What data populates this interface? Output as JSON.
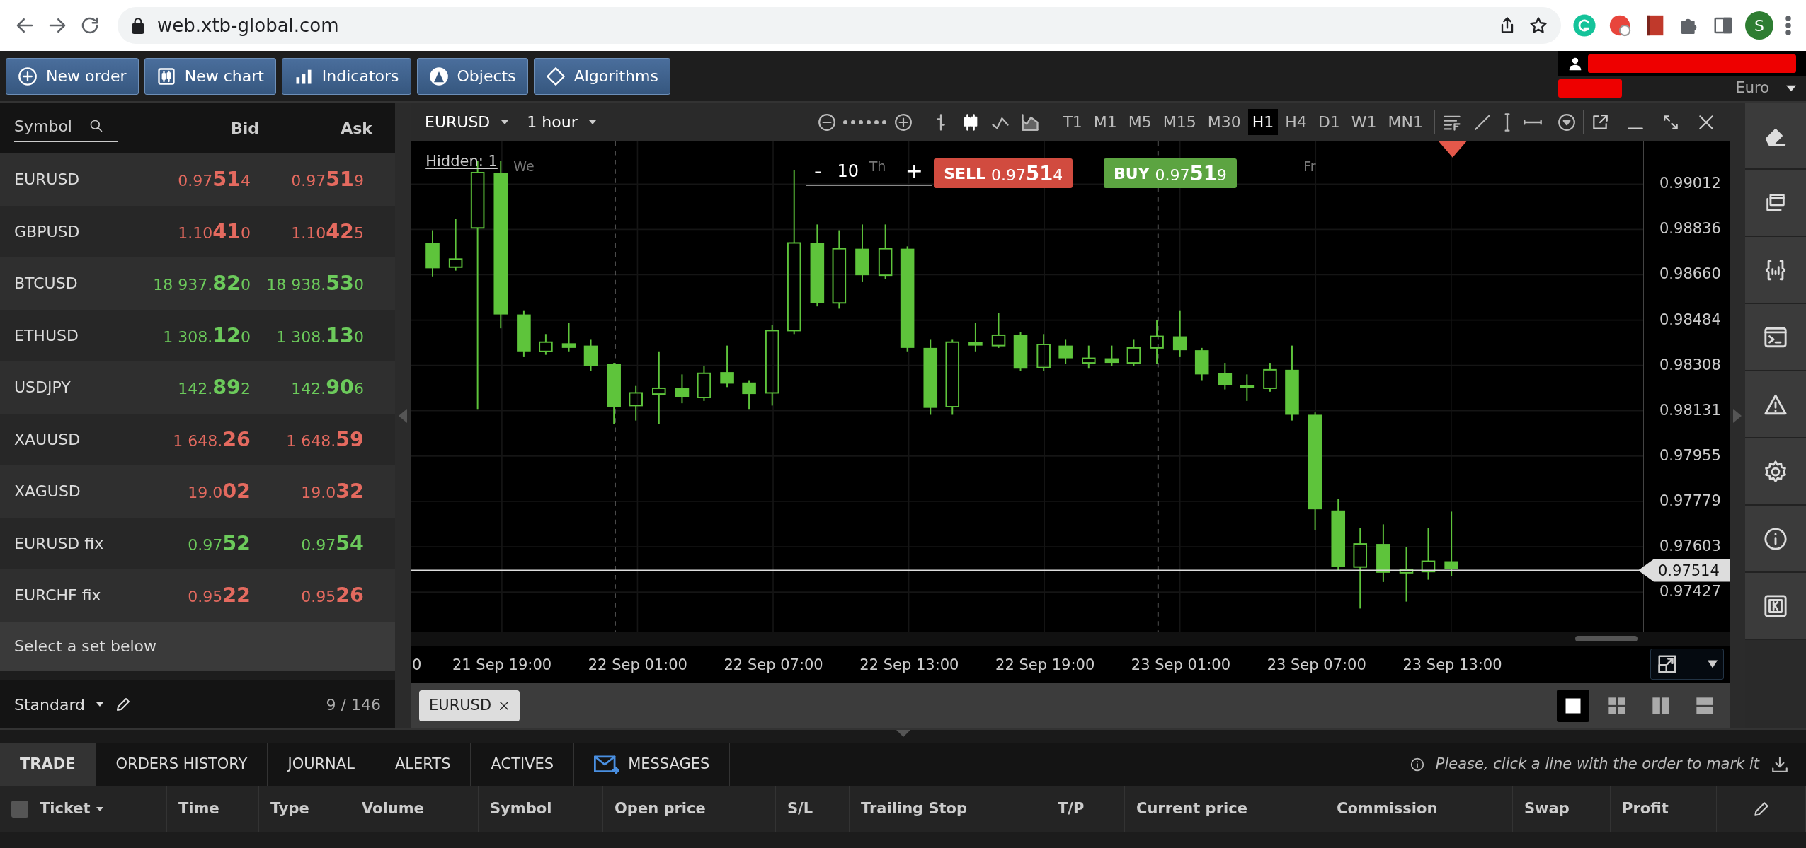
{
  "browser": {
    "url": "web.xtb-global.com",
    "profile_initial": "S"
  },
  "toolbar": {
    "buttons": [
      {
        "label": "New order",
        "kind": "order"
      },
      {
        "label": "New chart",
        "kind": "chart"
      },
      {
        "label": "Indicators",
        "kind": "indicators"
      },
      {
        "label": "Objects",
        "kind": "objects"
      },
      {
        "label": "Algorithms",
        "kind": "algorithms"
      }
    ],
    "account": {
      "currency": "Euro"
    }
  },
  "watchlist": {
    "columns": [
      "Symbol",
      "Bid",
      "Ask"
    ],
    "rows": [
      {
        "symbol": "EURUSD",
        "bid": "0.97**51**4",
        "ask": "0.97**51**9",
        "rising": false
      },
      {
        "symbol": "GBPUSD",
        "bid": "1.10**41**0",
        "ask": "1.10**42**5",
        "rising": false
      },
      {
        "symbol": "BTCUSD",
        "bid": "18 937.**82**0",
        "ask": "18 938.**53**0",
        "rising": true
      },
      {
        "symbol": "ETHUSD",
        "bid": "1 308.**12**0",
        "ask": "1 308.**13**0",
        "rising": true
      },
      {
        "symbol": "USDJPY",
        "bid": "142.**89**2",
        "ask": "142.**90**6",
        "rising": true
      },
      {
        "symbol": "XAUUSD",
        "bid": "1 648.**26**",
        "ask": "1 648.**59**",
        "rising": false
      },
      {
        "symbol": "XAGUSD",
        "bid": "19.0**02**",
        "ask": "19.0**32**",
        "rising": false
      },
      {
        "symbol": "EURUSD fix",
        "bid": "0.97**52**",
        "ask": "0.97**54**",
        "rising": true
      },
      {
        "symbol": "EURCHF fix",
        "bid": "0.95**22**",
        "ask": "0.95**26**",
        "rising": false
      }
    ],
    "hint": "Select a set below",
    "set_name": "Standard",
    "count": "9 / 146"
  },
  "chart": {
    "symbol": "EURUSD",
    "timeframe": "1 hour",
    "chart_styles": [
      {
        "kind": "bar",
        "selected": false
      },
      {
        "kind": "candles",
        "selected": true
      },
      {
        "kind": "line",
        "selected": false
      },
      {
        "kind": "area",
        "selected": false
      }
    ],
    "intervals": [
      {
        "label": "T1",
        "selected": false
      },
      {
        "label": "M1",
        "selected": false
      },
      {
        "label": "M5",
        "selected": false
      },
      {
        "label": "M15",
        "selected": false
      },
      {
        "label": "M30",
        "selected": false
      },
      {
        "label": "H1",
        "selected": true
      },
      {
        "label": "H4",
        "selected": false
      },
      {
        "label": "D1",
        "selected": false
      },
      {
        "label": "W1",
        "selected": false
      },
      {
        "label": "MN1",
        "selected": false
      }
    ],
    "hidden_label": "Hidden: 1",
    "day_labels": [
      "We",
      "Th",
      "Fr"
    ],
    "order_ticket": {
      "minus": "-",
      "volume": "10",
      "plus": "+",
      "sell_label": "SELL",
      "sell_price": "0.97**51**4",
      "buy_label": "BUY",
      "buy_price": "0.97**51**9"
    },
    "price_ticks": [
      "0.99012",
      "0.98836",
      "0.98660",
      "0.98484",
      "0.98308",
      "0.98131",
      "0.97955",
      "0.97779",
      "0.97603",
      "0.97427"
    ],
    "current_price": "0.97514",
    "time_ticks": [
      "0",
      "21 Sep 19:00",
      "22 Sep 01:00",
      "22 Sep 07:00",
      "22 Sep 13:00",
      "22 Sep 19:00",
      "23 Sep 01:00",
      "23 Sep 07:00",
      "23 Sep 13:00"
    ],
    "tabs": [
      {
        "label": "EURUSD"
      }
    ],
    "layouts": [
      {
        "kind": "single",
        "selected": true
      },
      {
        "kind": "grid",
        "selected": false
      },
      {
        "kind": "columns",
        "selected": false
      },
      {
        "kind": "rows",
        "selected": false
      }
    ]
  },
  "bottom": {
    "tabs": [
      {
        "label": "TRADE",
        "kind": "plain",
        "selected": true
      },
      {
        "label": "ORDERS HISTORY",
        "kind": "plain",
        "selected": false
      },
      {
        "label": "JOURNAL",
        "kind": "plain",
        "selected": false
      },
      {
        "label": "ALERTS",
        "kind": "plain",
        "selected": false
      },
      {
        "label": "ACTIVES",
        "kind": "plain",
        "selected": false
      },
      {
        "label": "MESSAGES",
        "kind": "messages",
        "selected": false
      }
    ],
    "hint": "Please, click a line with the order to mark it",
    "select_all_checked": false,
    "columns": [
      {
        "label": "Ticket",
        "dropdown": true
      },
      {
        "label": "Time",
        "dropdown": false
      },
      {
        "label": "Type",
        "dropdown": false
      },
      {
        "label": "Volume",
        "dropdown": false
      },
      {
        "label": "Symbol",
        "dropdown": false
      },
      {
        "label": "Open price",
        "dropdown": false
      },
      {
        "label": "S/L",
        "dropdown": false
      },
      {
        "label": "Trailing Stop",
        "dropdown": false
      },
      {
        "label": "T/P",
        "dropdown": false
      },
      {
        "label": "Current price",
        "dropdown": false
      },
      {
        "label": "Commission",
        "dropdown": false
      },
      {
        "label": "Swap",
        "dropdown": false
      },
      {
        "label": "Profit",
        "dropdown": false
      }
    ]
  }
}
